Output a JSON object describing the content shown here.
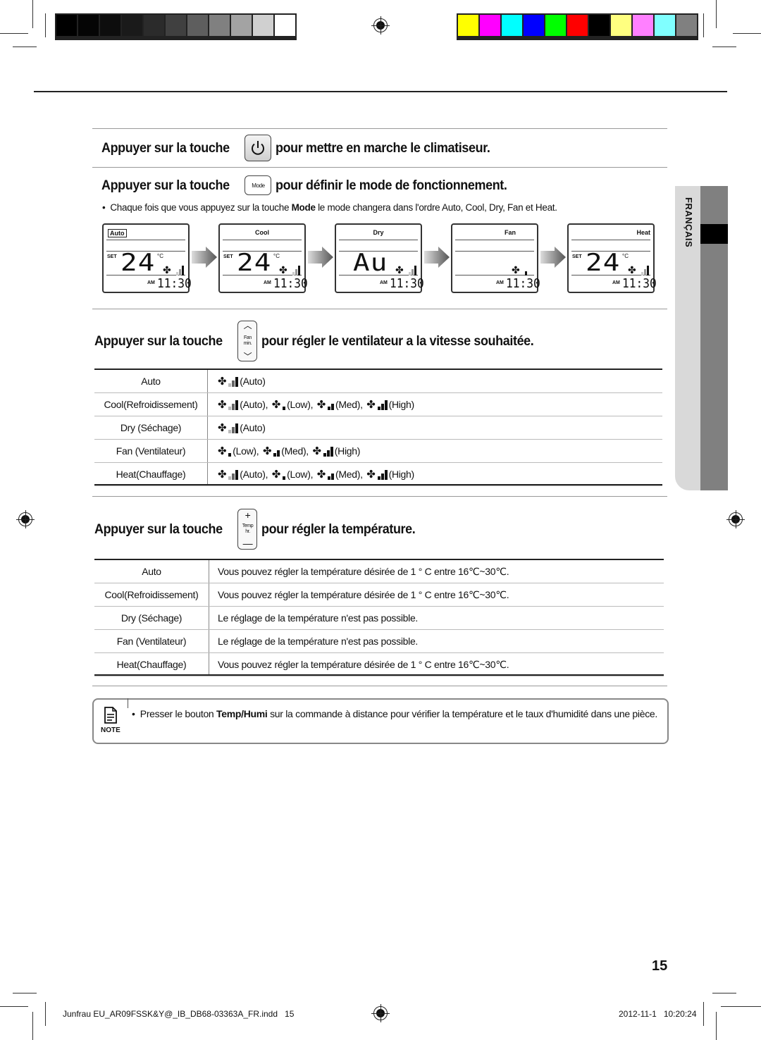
{
  "print_marks": {
    "gray_swatches": [
      "#000000",
      "#050505",
      "#0d0d0d",
      "#1a1a1a",
      "#2b2b2b",
      "#404040",
      "#5e5e5e",
      "#808080",
      "#a3a3a3",
      "#d0d0d0",
      "#ffffff"
    ],
    "color_swatches": [
      "#ffff00",
      "#ff00ff",
      "#00ffff",
      "#0000ff",
      "#00ff00",
      "#ff0000",
      "#000000",
      "#ffff80",
      "#ff80ff",
      "#80ffff",
      "#808080"
    ]
  },
  "side_tab": {
    "label": "FRANÇAIS"
  },
  "section_power": {
    "prefix": "Appuyer sur la touche",
    "suffix": "pour mettre en marche le climatiseur.",
    "key_icon": "power-icon"
  },
  "section_mode": {
    "prefix": "Appuyer sur la touche",
    "key_label": "Mode",
    "suffix": "pour définir le mode de fonctionnement.",
    "bullet_pre": "Chaque fois que vous appuyez sur la touche ",
    "bullet_bold": "Mode",
    "bullet_post": " le mode changera dans l'ordre Auto, Cool, Dry, Fan et Heat.",
    "displays": [
      {
        "mode": "Auto",
        "set": "SET",
        "value": "24",
        "unit": "°C",
        "am": "AM",
        "time": "11:30",
        "fan_bars": "auto"
      },
      {
        "mode": "Cool",
        "set": "SET",
        "value": "24",
        "unit": "°C",
        "am": "AM",
        "time": "11:30",
        "fan_bars": "auto"
      },
      {
        "mode": "Dry",
        "set": "",
        "value": "Au",
        "unit": "",
        "am": "AM",
        "time": "11:30",
        "fan_bars": "auto"
      },
      {
        "mode": "Fan",
        "set": "",
        "value": "",
        "unit": "",
        "am": "AM",
        "time": "11:30",
        "fan_bars": "low"
      },
      {
        "mode": "Heat",
        "set": "SET",
        "value": "24",
        "unit": "°C",
        "am": "AM",
        "time": "11:30",
        "fan_bars": "auto"
      }
    ]
  },
  "section_fan": {
    "prefix": "Appuyer sur la touche",
    "key_top": "Fan",
    "key_bottom": "min.",
    "suffix": "pour régler le ventilateur a la vitesse souhaitée.",
    "rows": [
      {
        "mode": "Auto",
        "speeds": [
          {
            "type": "auto",
            "label": "(Auto)"
          }
        ]
      },
      {
        "mode": "Cool(Refroidissement)",
        "speeds": [
          {
            "type": "auto",
            "label": "(Auto),"
          },
          {
            "type": "low",
            "label": "(Low),"
          },
          {
            "type": "med",
            "label": "(Med),"
          },
          {
            "type": "high",
            "label": "(High)"
          }
        ]
      },
      {
        "mode": "Dry (Séchage)",
        "speeds": [
          {
            "type": "auto",
            "label": "(Auto)"
          }
        ]
      },
      {
        "mode": "Fan (Ventilateur)",
        "speeds": [
          {
            "type": "low",
            "label": "(Low),"
          },
          {
            "type": "med",
            "label": "(Med),"
          },
          {
            "type": "high",
            "label": "(High)"
          }
        ]
      },
      {
        "mode": "Heat(Chauffage)",
        "speeds": [
          {
            "type": "auto",
            "label": "(Auto),"
          },
          {
            "type": "low",
            "label": "(Low),"
          },
          {
            "type": "med",
            "label": "(Med),"
          },
          {
            "type": "high",
            "label": "(High)"
          }
        ]
      }
    ]
  },
  "section_temp": {
    "prefix": "Appuyer sur la touche",
    "key_top": "Temp",
    "key_bottom": "hr.",
    "suffix": "pour régler la température.",
    "rows": [
      {
        "mode": "Auto",
        "desc": "Vous pouvez régler la température désirée de 1 ° C entre 16℃~30℃."
      },
      {
        "mode": "Cool(Refroidissement)",
        "desc": "Vous pouvez régler la température désirée de 1 ° C entre 16℃~30℃."
      },
      {
        "mode": "Dry (Séchage)",
        "desc": "Le réglage de la température n'est pas possible."
      },
      {
        "mode": "Fan (Ventilateur)",
        "desc": "Le réglage de la température n'est pas possible."
      },
      {
        "mode": "Heat(Chauffage)",
        "desc": "Vous pouvez régler la température désirée de 1 ° C entre 16℃~30℃."
      }
    ]
  },
  "note": {
    "label": "NOTE",
    "pre": "Presser le bouton ",
    "bold": "Temp/Humi",
    "post": " sur la commande à distance pour vérifier la température et le taux d'humidité dans une pièce."
  },
  "page_number": "15",
  "footer": {
    "file": "Junfrau EU_AR09FSSK&Y@_IB_DB68-03363A_FR.indd   15",
    "datetime": "2012-11-1   10:20:24"
  }
}
